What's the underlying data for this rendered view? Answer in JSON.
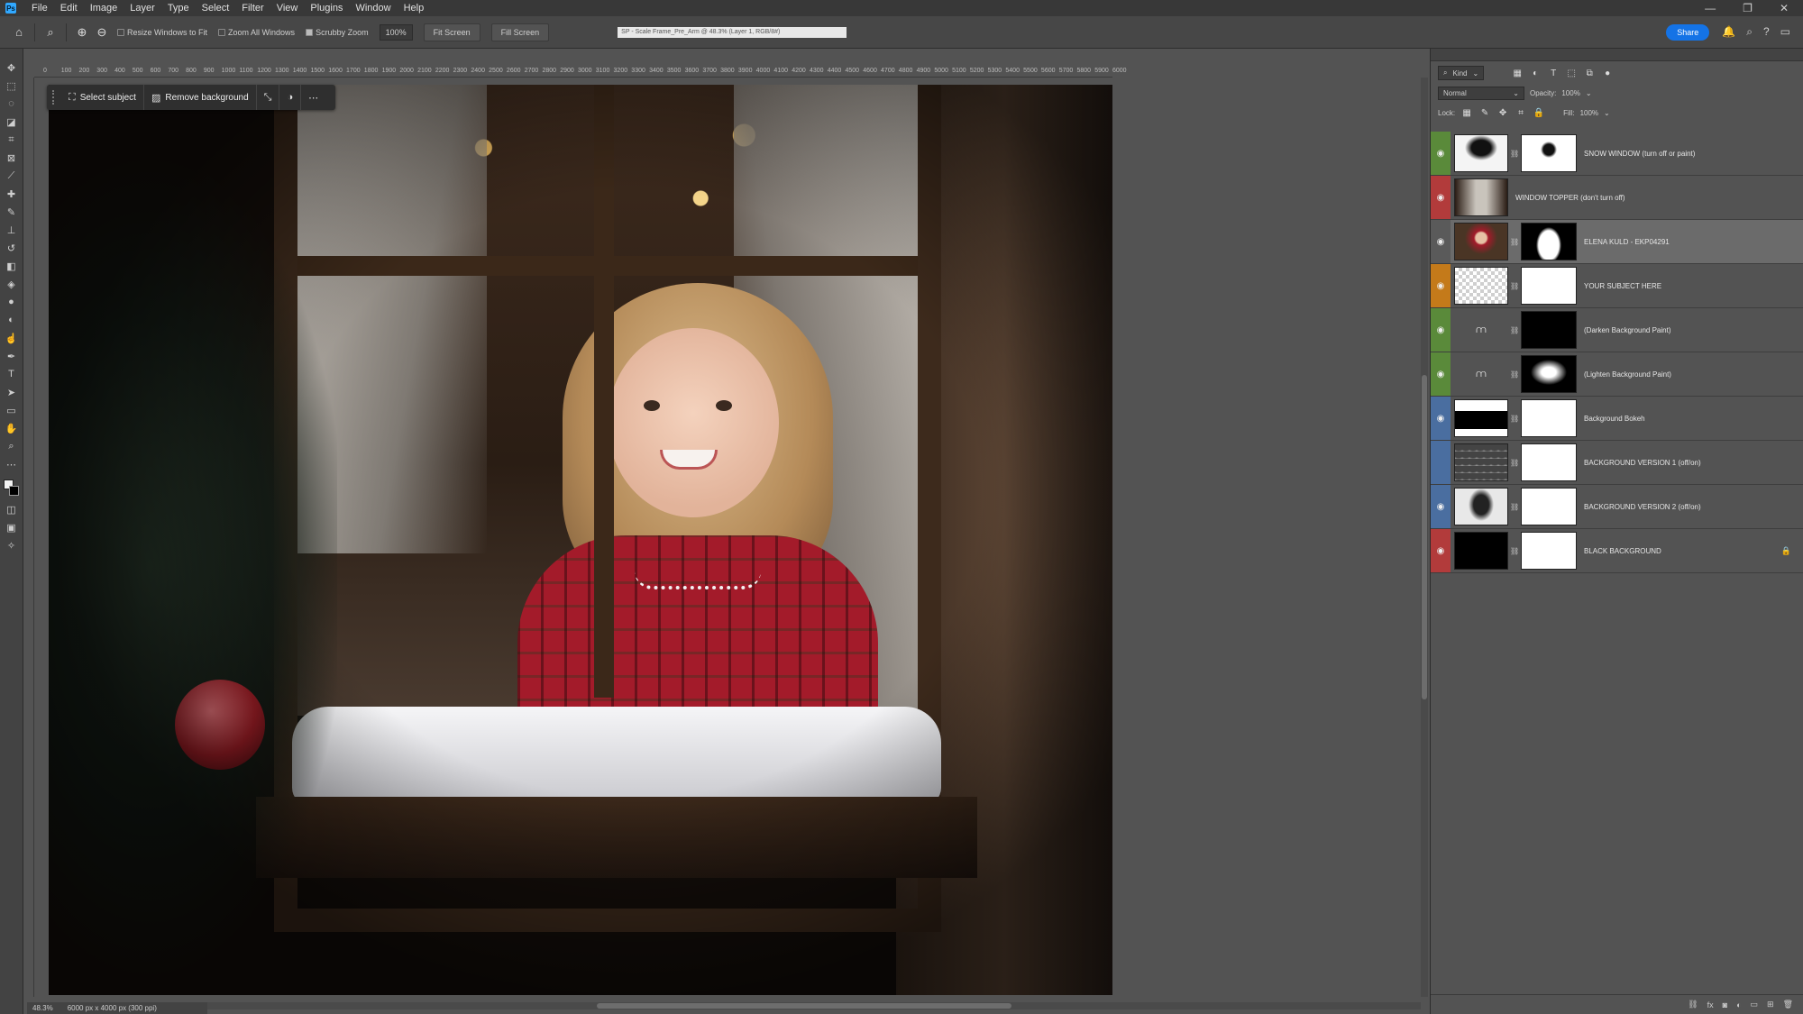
{
  "menu": {
    "app_logo": "Ps",
    "items": [
      "File",
      "Edit",
      "Image",
      "Layer",
      "Type",
      "Select",
      "Filter",
      "View",
      "Plugins",
      "Window",
      "Help"
    ],
    "window_controls": [
      "—",
      "❐",
      "✕"
    ]
  },
  "options_bar": {
    "resize_windows": "Resize Windows to Fit",
    "zoom_all": "Zoom All Windows",
    "scrubby_zoom": "Scrubby Zoom",
    "zoom_value": "100%",
    "fit_screen": "Fit Screen",
    "fill_screen": "Fill Screen",
    "document_tab": "SP - Scale Frame_Pre_Arm @ 48.3% (Layer 1, RGB/8#)",
    "share": "Share"
  },
  "context_bar": {
    "select_subject": "Select subject",
    "remove_background": "Remove background"
  },
  "ruler": {
    "ticks": [
      "0",
      "100",
      "200",
      "300",
      "400",
      "500",
      "600",
      "700",
      "800",
      "900",
      "1000",
      "1100",
      "1200",
      "1300",
      "1400",
      "1500",
      "1600",
      "1700",
      "1800",
      "1900",
      "2000",
      "2100",
      "2200",
      "2300",
      "2400",
      "2500",
      "2600",
      "2700",
      "2800",
      "2900",
      "3000",
      "3100",
      "3200",
      "3300",
      "3400",
      "3500",
      "3600",
      "3700",
      "3800",
      "3900",
      "4000",
      "4100",
      "4200",
      "4300",
      "4400",
      "4500",
      "4600",
      "4700",
      "4800",
      "4900",
      "5000",
      "5100",
      "5200",
      "5300",
      "5400",
      "5500",
      "5600",
      "5700",
      "5800",
      "5900",
      "6000"
    ]
  },
  "status": {
    "zoom": "48.3%",
    "doc_size": "6000 px x 4000 px (300 ppi)"
  },
  "layers_panel": {
    "filter_kind": "Kind",
    "blend_mode": "Normal",
    "opacity_label": "Opacity:",
    "opacity_value": "100%",
    "lock_label": "Lock:",
    "fill_label": "Fill:",
    "fill_value": "100%",
    "layers": [
      {
        "name": "SNOW WINDOW (turn off or paint)",
        "tag_color": "#5a8a3a",
        "visible": true
      },
      {
        "name": "WINDOW TOPPER (don't turn off)",
        "tag_color": "#b23b3b",
        "visible": true
      },
      {
        "name": "ELENA KULD - EKP04291",
        "tag_color": "#5a5a5a",
        "visible": true
      },
      {
        "name": "YOUR SUBJECT HERE",
        "tag_color": "#c47a1a",
        "visible": true
      },
      {
        "name": "(Darken Background Paint)",
        "tag_color": "#5a8a3a",
        "visible": true
      },
      {
        "name": "(Lighten Background Paint)",
        "tag_color": "#5a8a3a",
        "visible": true
      },
      {
        "name": "Background Bokeh",
        "tag_color": "#4a6ea0",
        "visible": true
      },
      {
        "name": "BACKGROUND VERSION 1 (off/on)",
        "tag_color": "#4a6ea0",
        "visible": false
      },
      {
        "name": "BACKGROUND VERSION 2 (off/on)",
        "tag_color": "#4a6ea0",
        "visible": true
      },
      {
        "name": "BLACK BACKGROUND",
        "tag_color": "#b23b3b",
        "visible": true
      }
    ]
  }
}
